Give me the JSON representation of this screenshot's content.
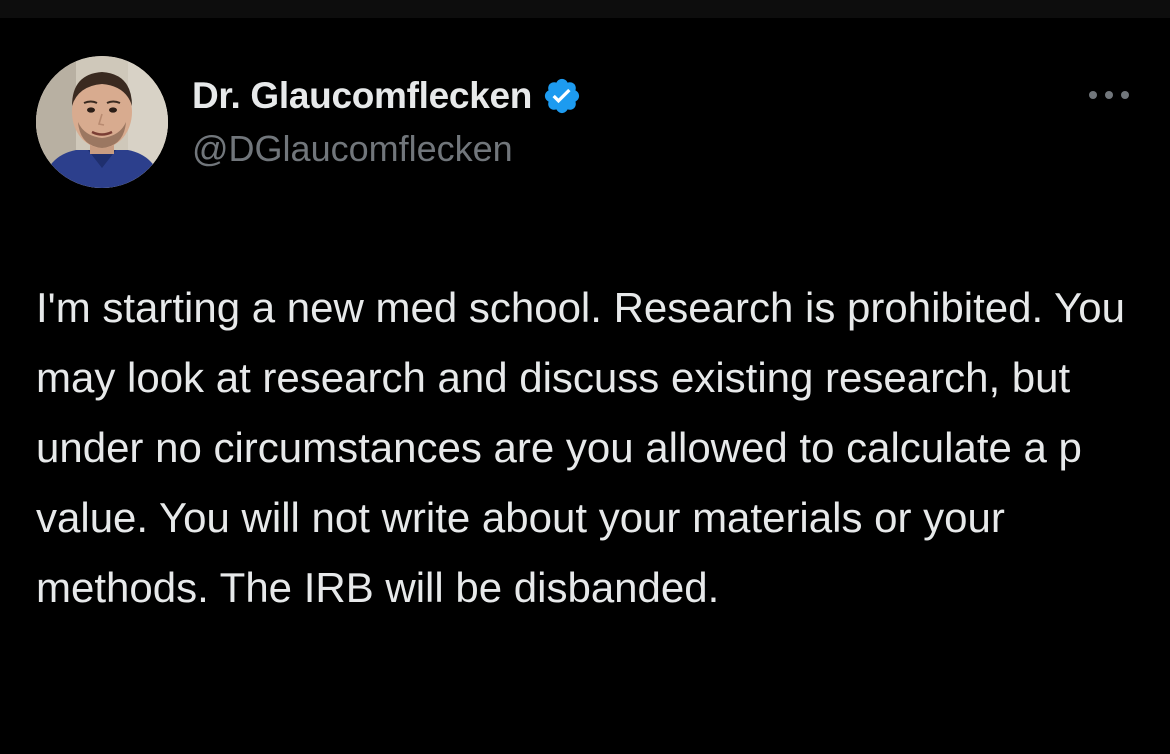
{
  "tweet": {
    "author": {
      "display_name": "Dr. Glaucomflecken",
      "handle": "@DGlaucomflecken",
      "verified": true,
      "verified_badge_color": "#1d9bf0",
      "avatar_icon": "profile-photo"
    },
    "more_icon": "more-horizontal-icon",
    "text": "I'm starting a new med school. Research is prohibited. You may look at research and discuss existing research, but under no circumstances are you allowed to calculate a p value. You will not write about your materials or your methods. The IRB will be disbanded."
  },
  "colors": {
    "background": "#000000",
    "primary_text": "#e7e9ea",
    "secondary_text": "#71767b",
    "accent": "#1d9bf0"
  }
}
